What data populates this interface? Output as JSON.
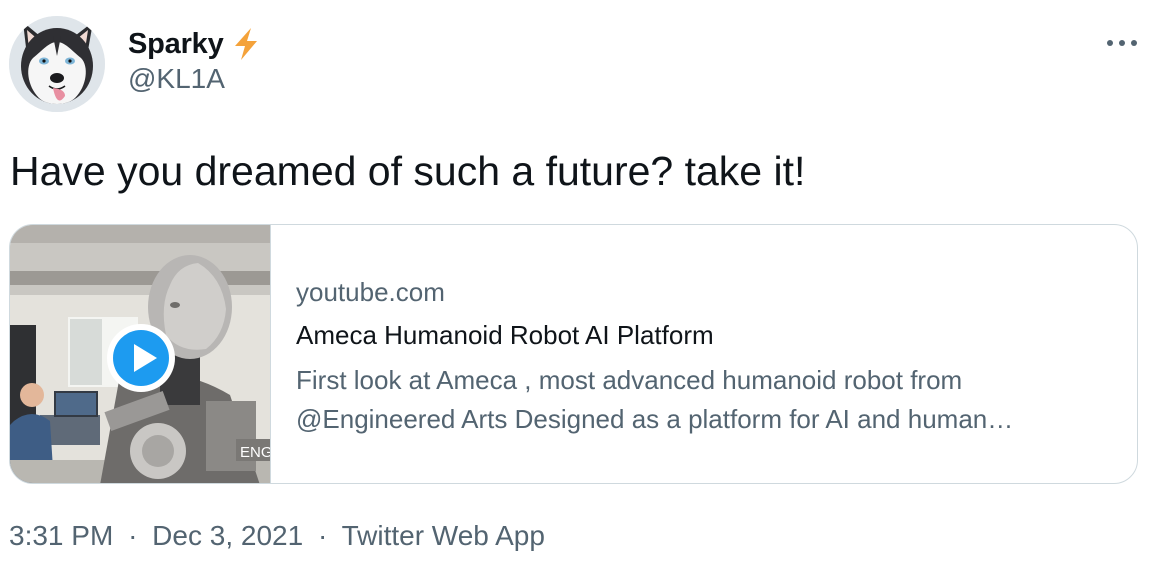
{
  "author": {
    "display_name": "Sparky",
    "handle": "@KL1A",
    "badge_icon": "lightning-bolt-icon",
    "badge_color": "#f4a23a"
  },
  "tweet": {
    "text": "Have you dreamed of such a future? take it!"
  },
  "card": {
    "domain": "youtube.com",
    "title": "Ameca Humanoid Robot AI Platform",
    "description_line1": "First look at Ameca , most advanced humanoid robot from",
    "description_line2": "@Engineered Arts Designed as a platform for AI and human…",
    "thumbnail_overlay_text": "ENG",
    "play_button_color": "#1d9bf0"
  },
  "meta": {
    "time": "3:31 PM",
    "separator": "·",
    "date": "Dec 3, 2021",
    "source": "Twitter Web App"
  },
  "menu": {
    "icon": "more-horizontal-icon"
  }
}
